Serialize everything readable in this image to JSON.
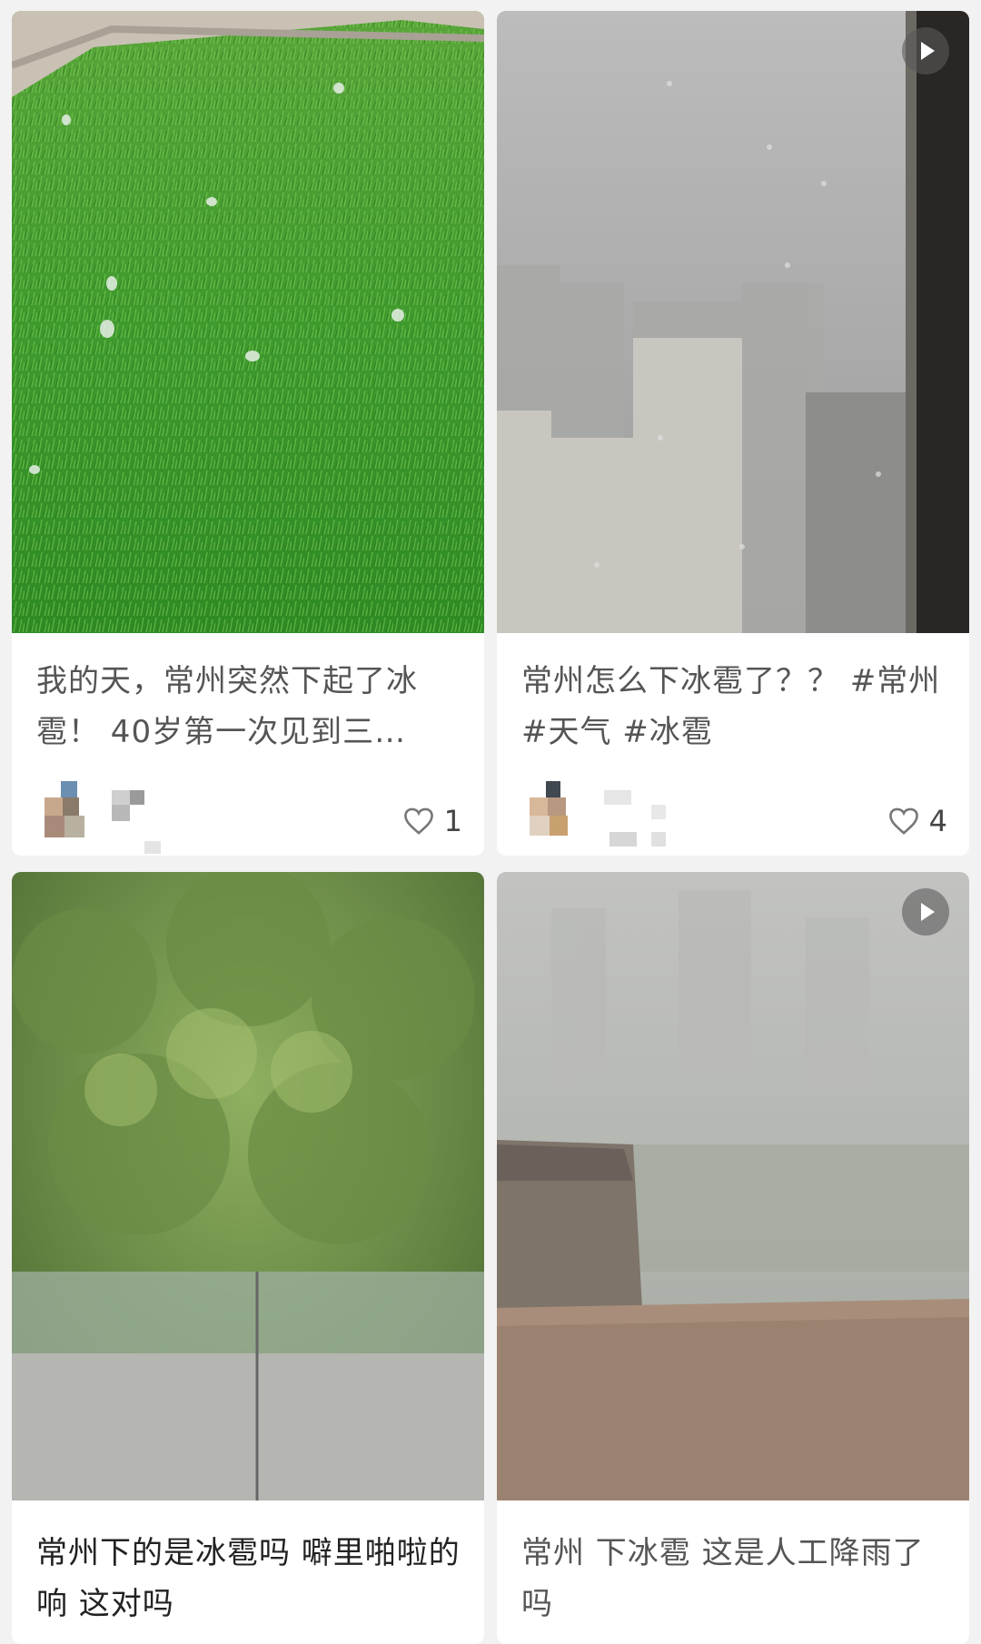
{
  "feed": {
    "posts": [
      {
        "title": "我的天，常州突然下起了冰雹！ 40岁第一次见到三…",
        "likes": "1",
        "has_video": false,
        "image": "grass with hailstones"
      },
      {
        "title": "常州怎么下冰雹了？？ #常州 #天气 #冰雹",
        "likes": "4",
        "has_video": true,
        "image": "foggy city buildings through rainy window"
      },
      {
        "title": "常州下的是冰雹吗 噼里啪啦的响 这对吗",
        "has_video": false,
        "image": "trees behind glass balcony railing"
      },
      {
        "title": "常州 下冰雹 这是人工降雨了吗",
        "has_video": true,
        "image": "hazy rooftop view with ledge"
      }
    ]
  },
  "icons": {
    "like": "heart-outline-icon",
    "play": "play-icon"
  },
  "colors": {
    "background": "#f2f2f2",
    "card": "#ffffff",
    "text": "#333333"
  }
}
